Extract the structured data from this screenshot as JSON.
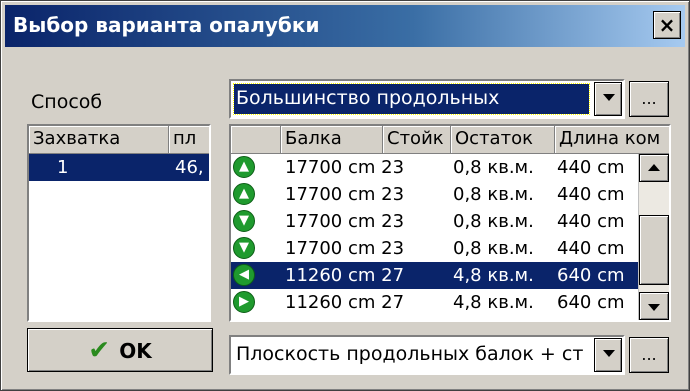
{
  "window": {
    "title": "Выбор варианта опалубки",
    "close_label": "×"
  },
  "method": {
    "label": "Способ",
    "value": "Большинство продольных",
    "more_label": "..."
  },
  "zones": {
    "headers": [
      "Захватка",
      "пл"
    ],
    "rows": [
      {
        "name": "1",
        "area": "46,"
      }
    ]
  },
  "variants": {
    "headers": [
      "",
      "Балка",
      "Стойк",
      "Остаток",
      "Длина ком"
    ],
    "rows": [
      {
        "icon": "arrow-up-icon",
        "glyph": "▲",
        "beam": "17700 cm 23",
        "remainder": "0,8 кв.м.",
        "length": "440 cm"
      },
      {
        "icon": "arrow-up-icon",
        "glyph": "▲",
        "beam": "17700 cm 23",
        "remainder": "0,8 кв.м.",
        "length": "440 cm"
      },
      {
        "icon": "arrow-down-icon",
        "glyph": "▼",
        "beam": "17700 cm 23",
        "remainder": "0,8 кв.м.",
        "length": "440 cm"
      },
      {
        "icon": "arrow-down-icon",
        "glyph": "▼",
        "beam": "17700 cm 23",
        "remainder": "0,8 кв.м.",
        "length": "440 cm"
      },
      {
        "icon": "arrow-left-icon",
        "glyph": "◀",
        "beam": "11260 cm 27",
        "remainder": "4,8 кв.м.",
        "length": "640 cm"
      },
      {
        "icon": "arrow-right-icon",
        "glyph": "▶",
        "beam": "11260 cm 27",
        "remainder": "4,8 кв.м.",
        "length": "640 cm"
      }
    ]
  },
  "ok_button": {
    "label": "OK",
    "check": "✔"
  },
  "plane": {
    "value": "Плоскость продольных балок + ст",
    "more_label": "..."
  },
  "colors": {
    "selection": "#0a246a",
    "face": "#d4d0c8",
    "icon_green": "#1f9a2e",
    "check_green": "#2a8a1e"
  }
}
